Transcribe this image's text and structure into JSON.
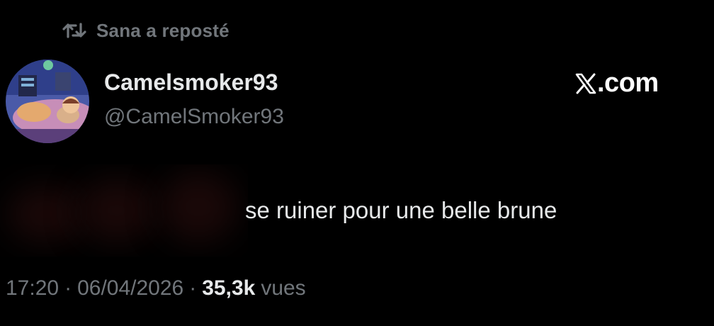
{
  "repost": {
    "icon": "repost-icon",
    "text": "Sana a reposté"
  },
  "author": {
    "avatar": "avatar-image",
    "display_name": "Camelsmoker93",
    "handle": "@CamelSmoker93"
  },
  "brand": {
    "icon": "x-logo-icon",
    "text": ".com"
  },
  "tweet": {
    "text": "se ruiner pour une belle brune"
  },
  "meta": {
    "time": "17:20",
    "separator": "·",
    "date": "06/04/2026",
    "views_count": "35,3k",
    "views_label": "vues"
  },
  "colors": {
    "background": "#000000",
    "primary_text": "#e7e9ea",
    "secondary_text": "#71767b"
  }
}
